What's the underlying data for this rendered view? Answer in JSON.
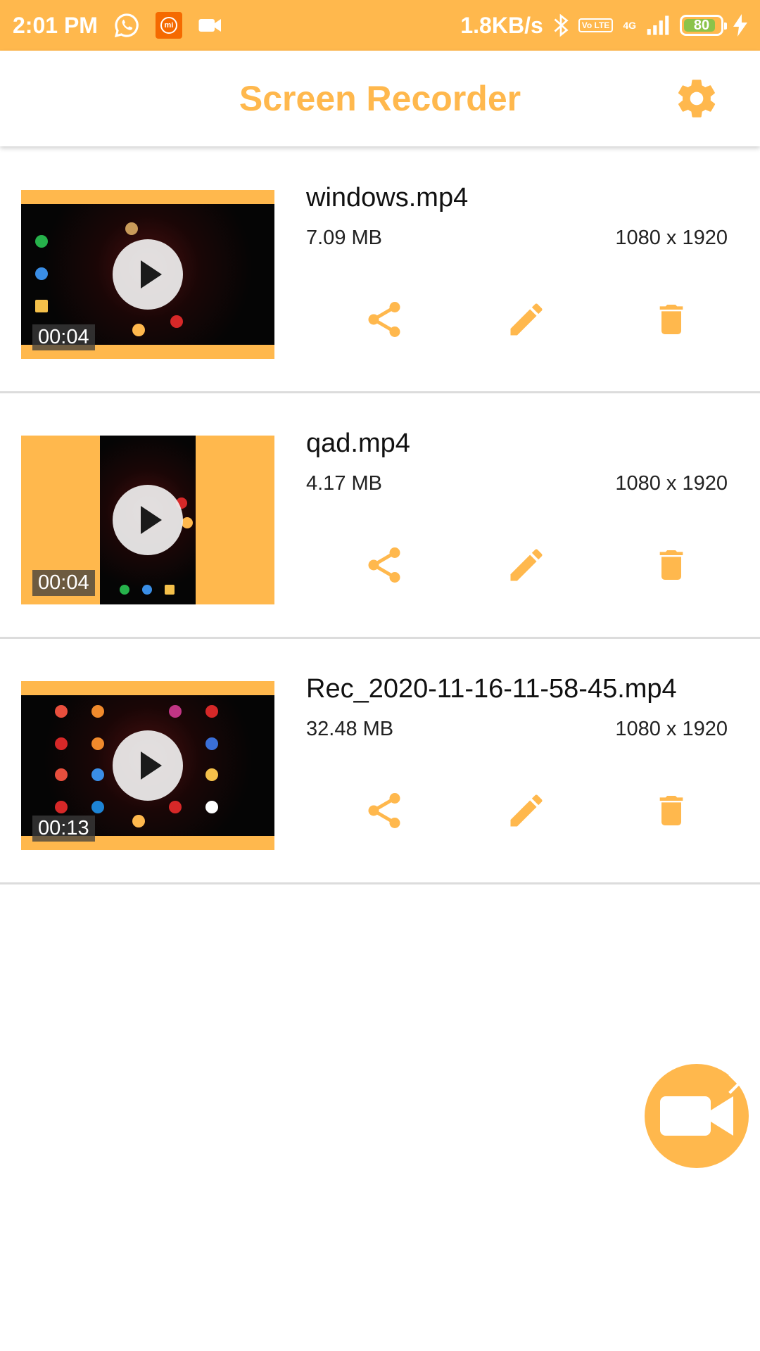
{
  "status_bar": {
    "time": "2:01 PM",
    "left_icons": [
      "whatsapp-icon",
      "mi-icon",
      "video-camera-icon"
    ],
    "net_speed": "1.8KB/s",
    "volte_label": "Vo LTE",
    "network_type": "4G",
    "battery_level": "80",
    "colors": {
      "background": "#FFB84D",
      "battery_fill": "#8BC34A"
    }
  },
  "app_bar": {
    "title": "Screen Recorder",
    "settings_icon": "gear-icon",
    "accent_color": "#FFB84D"
  },
  "recordings": [
    {
      "name": "windows.mp4",
      "size": "7.09 MB",
      "resolution": "1080 x 1920",
      "duration": "00:04",
      "thumb_orientation": "landscape"
    },
    {
      "name": "qad.mp4",
      "size": "4.17 MB",
      "resolution": "1080 x 1920",
      "duration": "00:04",
      "thumb_orientation": "portrait"
    },
    {
      "name": "Rec_2020-11-16-11-58-45.mp4",
      "size": "32.48 MB",
      "resolution": "1080 x 1920",
      "duration": "00:13",
      "thumb_orientation": "landscape"
    }
  ],
  "row_actions": [
    "share-icon",
    "edit-pencil-icon",
    "delete-trash-icon"
  ],
  "fab": {
    "icon": "video-camera-icon",
    "close_icon": "close-icon"
  }
}
